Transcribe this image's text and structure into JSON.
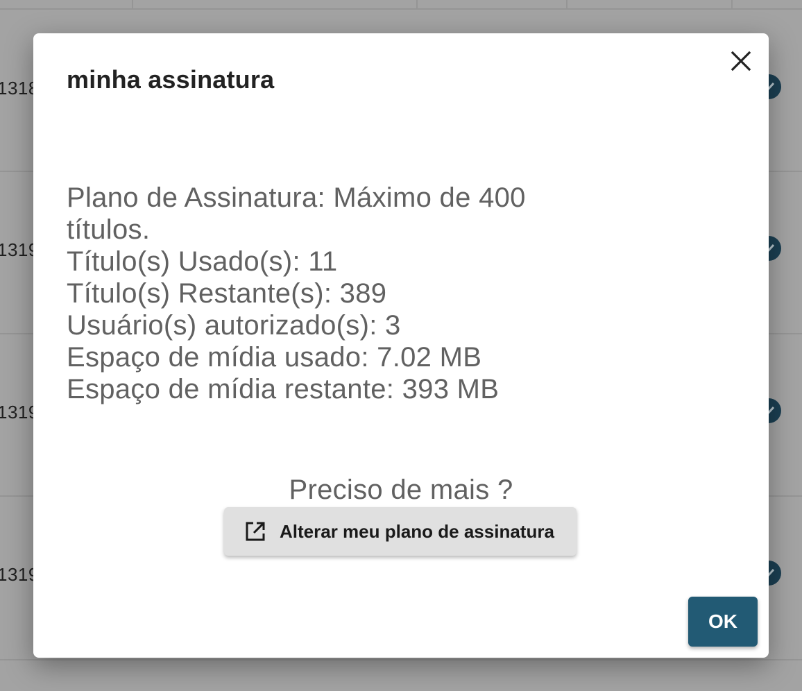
{
  "background": {
    "row_ids": [
      "1318",
      "1319",
      "1319",
      "1319"
    ]
  },
  "dialog": {
    "title": "minha assinatura",
    "info_lines": [
      "Plano de Assinatura: Máximo de 400 títulos.",
      "Título(s) Usado(s): 11",
      "Título(s) Restante(s): 389",
      "Usuário(s) autorizado(s): 3",
      "Espaço de mídia usado: 7.02 MB",
      "Espaço de mídia restante: 393 MB"
    ],
    "need_more": "Preciso de mais ?",
    "change_plan_label": "Alterar meu plano de assinatura",
    "ok_label": "OK"
  },
  "colors": {
    "accent": "#225a74",
    "overlay": "#9e9e9e",
    "check": "#1b3f52"
  },
  "icons": {
    "close": "close-icon",
    "change_plan": "open-in-new-icon",
    "row_check": "check-circle-icon"
  }
}
